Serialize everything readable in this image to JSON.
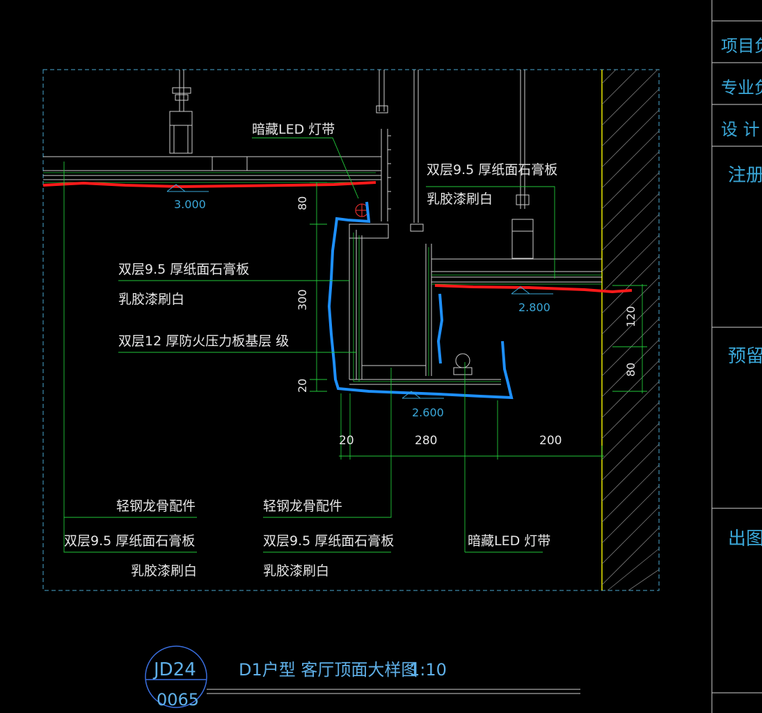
{
  "drawing": {
    "callouts": {
      "led_top": "暗藏LED 灯带",
      "board_top_right_1": "双层9.5 厚纸面石膏板",
      "board_top_right_2": "乳胶漆刷白",
      "board_mid_1": "双层9.5 厚纸面石膏板",
      "board_mid_2": "乳胶漆刷白",
      "fire_board": "双层12 厚防火压力板基层 级",
      "bl_keel": "轻钢龙骨配件",
      "bl_board": "双层9.5 厚纸面石膏板",
      "bl_paint": "乳胶漆刷白",
      "bm_keel": "轻钢龙骨配件",
      "bm_board": "双层9.5 厚纸面石膏板",
      "bm_paint": "乳胶漆刷白",
      "led_bottom": "暗藏LED 灯带"
    },
    "levels": [
      "3.000",
      "2.800",
      "2.600"
    ],
    "dims": {
      "v80_left": "80",
      "v300": "300",
      "v20": "20",
      "h20": "20",
      "h280": "280",
      "h200": "200",
      "v120_right": "120",
      "v80_right": "80"
    }
  },
  "title_block": {
    "sheet_code": "JD24",
    "sheet_no": "0065",
    "title": "D1户型 客厅顶面大样图",
    "scale": "1:10"
  },
  "side_panel": {
    "rows": [
      "项目负",
      "专业负",
      "设  计",
      "注册",
      "预留",
      "出图"
    ]
  },
  "colors": {
    "background": "#000000",
    "cad_green": "#22c93a",
    "cad_blue": "#1e90ff",
    "cad_red": "#ff1a1a",
    "cad_yellow": "#e8e800",
    "cad_cyan": "#3aa7d8"
  }
}
